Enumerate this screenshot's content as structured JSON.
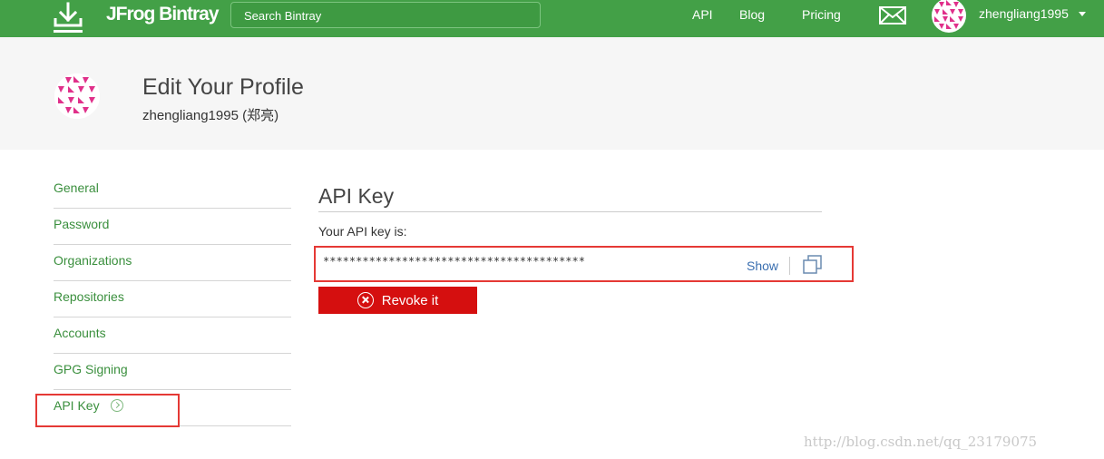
{
  "topbar": {
    "brand": "JFrog Bintray",
    "search_placeholder": "Search Bintray",
    "links": [
      "API",
      "Blog",
      "Pricing"
    ],
    "user": "zhengliang1995",
    "color": "#43a047"
  },
  "profile": {
    "title": "Edit Your Profile",
    "subtitle": "zhengliang1995 (郑亮)"
  },
  "sidebar": {
    "items": [
      {
        "label": "General"
      },
      {
        "label": "Password"
      },
      {
        "label": "Organizations"
      },
      {
        "label": "Repositories"
      },
      {
        "label": "Accounts"
      },
      {
        "label": "GPG Signing"
      },
      {
        "label": "API Key",
        "active": true
      }
    ]
  },
  "api_key": {
    "section_title": "API Key",
    "label": "Your API key is:",
    "masked_value": "****************************************",
    "show_label": "Show",
    "revoke_label": "Revoke it"
  },
  "watermark": "http://blog.csdn.net/qq_23179075",
  "icons": {
    "logo": "download-arrow-icon",
    "mail": "mail-icon",
    "copy": "copy-icon",
    "revoke": "close-circle-icon",
    "chevron": "chevron-right-circle-icon"
  }
}
